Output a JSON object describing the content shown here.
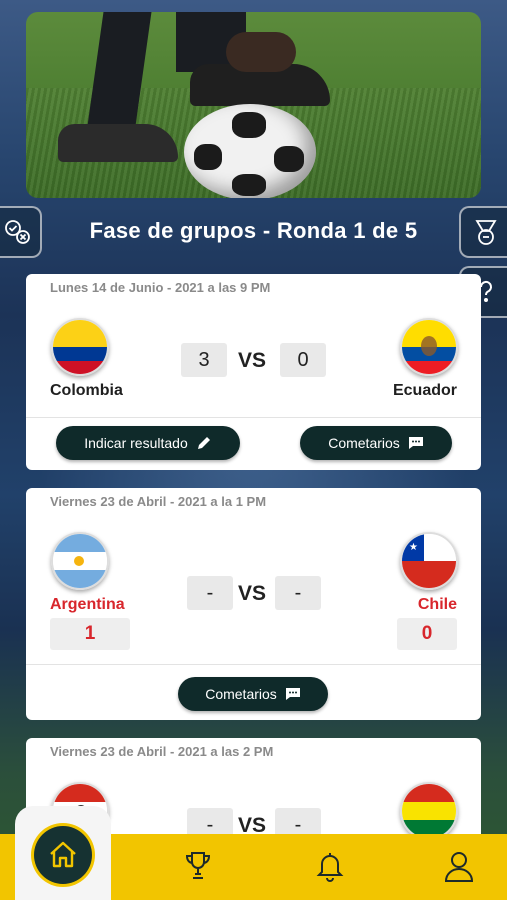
{
  "header": {
    "title": "Fase de grupos - Ronda 1 de 5"
  },
  "matches": [
    {
      "date": "Lunes 14 de Junio - 2021 a las 9 PM",
      "home": {
        "name": "Colombia"
      },
      "away": {
        "name": "Ecuador"
      },
      "home_score": "3",
      "away_score": "0",
      "vs": "VS",
      "actions": {
        "indicate_label": "Indicar resultado",
        "comments_label": "Cometarios"
      }
    },
    {
      "date": "Viernes 23 de Abril - 2021 a la 1 PM",
      "home": {
        "name": "Argentina"
      },
      "away": {
        "name": "Chile"
      },
      "home_score": "-",
      "away_score": "-",
      "vs": "VS",
      "home_prediction": "1",
      "away_prediction": "0",
      "actions": {
        "comments_label": "Cometarios"
      }
    },
    {
      "date": "Viernes 23 de Abril - 2021 a las 2 PM",
      "home_score": "-",
      "away_score": "-",
      "vs": "VS"
    }
  ],
  "icons": {
    "left_side": "prediction-check-icon",
    "right_side": "medal-icon",
    "help": "question-icon",
    "pencil": "pencil-icon",
    "comment": "comment-icon",
    "nav": [
      "home-icon",
      "trophy-icon",
      "bell-icon",
      "user-icon"
    ]
  },
  "colors": {
    "accent_yellow": "#f2c500",
    "dark_pill": "#0f2a2a",
    "team_highlight_red": "#d8262c"
  }
}
